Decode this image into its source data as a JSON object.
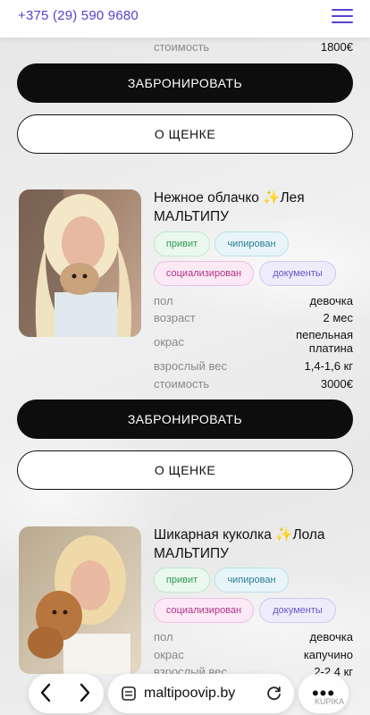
{
  "header": {
    "phone": "+375 (29) 590 9680",
    "menu_icon": "hamburger-icon"
  },
  "partial_card": {
    "price_label": "стоимость",
    "price_value": "1800€",
    "book_label": "ЗАБРОНИРОВАТЬ",
    "about_label": "О ЩЕНКЕ"
  },
  "cards": [
    {
      "title": "Нежное облачко ✨Лея",
      "breed": "МАЛЬТИПУ",
      "tags": [
        "привит",
        "чипирован",
        "социализирован",
        "документы"
      ],
      "specs": [
        {
          "k": "пол",
          "v": "девочка"
        },
        {
          "k": "возраст",
          "v": "2 мес"
        },
        {
          "k": "окрас",
          "v": "пепельная платина"
        },
        {
          "k": "взрослый вес",
          "v": "1,4-1,6 кг"
        },
        {
          "k": "стоимость",
          "v": "3000€"
        }
      ],
      "book_label": "ЗАБРОНИРОВАТЬ",
      "about_label": "О ЩЕНКЕ"
    },
    {
      "title": "Шикарная куколка ✨Лола",
      "breed": "МАЛЬТИПУ",
      "tags": [
        "привит",
        "чипирован",
        "социализирован",
        "документы"
      ],
      "specs": [
        {
          "k": "пол",
          "v": "девочка"
        },
        {
          "k": "окрас",
          "v": "капучино"
        },
        {
          "k": "взрослый вес",
          "v": "2-2,4 кг"
        }
      ]
    }
  ],
  "browser": {
    "url": "maltipoovip.by",
    "back_icon": "chevron-left-icon",
    "forward_icon": "chevron-right-icon",
    "more_label": "•••"
  },
  "watermark": "KUPIKA"
}
